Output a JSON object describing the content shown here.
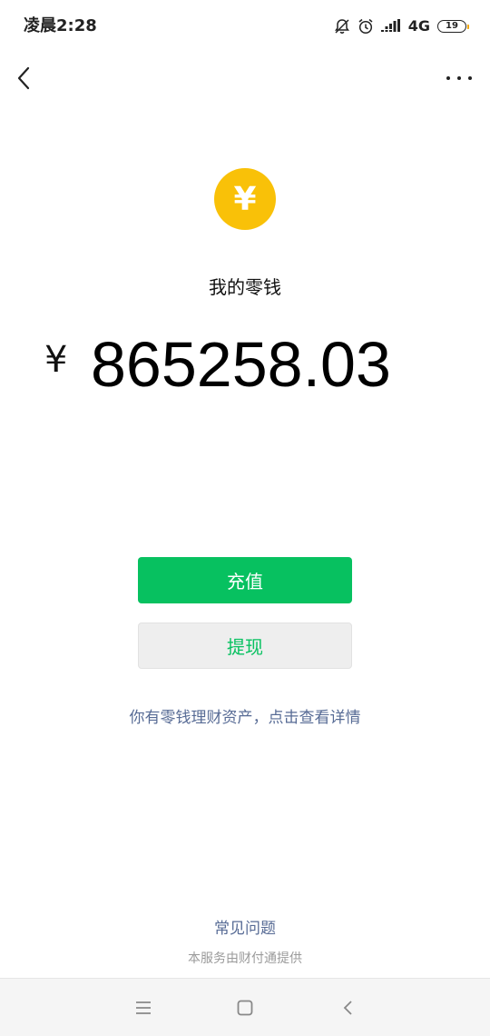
{
  "status_bar": {
    "time": "凌晨2:28",
    "network": "4G",
    "battery": "19"
  },
  "nav": {
    "back_icon": "chevron-left-icon",
    "more_icon": "more-dots-icon"
  },
  "wallet": {
    "coin_symbol": "¥",
    "title": "我的零钱",
    "currency": "¥",
    "balance": "865258.03"
  },
  "actions": {
    "recharge_label": "充值",
    "withdraw_label": "提现"
  },
  "finance_link": "你有零钱理财资产，点击查看详情",
  "footer": {
    "faq": "常见问题",
    "provider": "本服务由财付通提供"
  },
  "colors": {
    "primary_green": "#07c160",
    "link_blue": "#576b95",
    "coin_yellow": "#f9c108"
  }
}
